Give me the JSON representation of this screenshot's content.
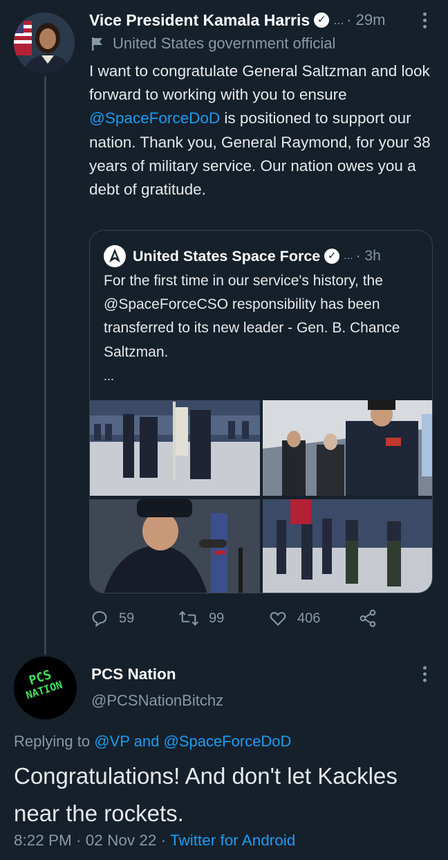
{
  "tweet": {
    "author_name": "Vice President Kamala Harris",
    "more": "...",
    "time": "· 29m",
    "label": "United States government official",
    "text_before": "I want to congratulate General Saltzman and look forward to working with you to ensure ",
    "mention": "@SpaceForceDoD",
    "text_after": " is positioned to support our nation. Thank you, General Raymond, for your 38 years of military service. Our nation owes you a debt of gratitude.",
    "quote": {
      "author_name": "United States Space Force",
      "more": "...",
      "time": "· 3h",
      "text": "For the first time in our service's history, the @SpaceForceCSO responsibility has been transferred to its new leader - Gen. B. Chance Saltzman.",
      "ellipsis": "..."
    },
    "stats": {
      "replies": "59",
      "retweets": "99",
      "likes": "406"
    }
  },
  "reply": {
    "author_name": "PCS Nation",
    "handle": "@PCSNationBitchz",
    "avatar_text_line1": "PCS",
    "avatar_text_line2": "NATION",
    "replying_prefix": "Replying to",
    "replying_to_1": "@VP",
    "replying_and": "and",
    "replying_to_2": "@SpaceForceDoD",
    "text": "Congratulations! And don't let Kackles near the rockets.",
    "time": "8:22 PM",
    "date": "02 Nov 22",
    "source": "Twitter for Android"
  },
  "colors": {
    "background": "#15202b",
    "link": "#1d9bf0",
    "muted": "#8899a6",
    "border": "#38444d",
    "pcs_green": "#3fe05f"
  },
  "icons": [
    "verified-badge-icon",
    "flag-icon",
    "space-force-logo-icon",
    "reply-icon",
    "retweet-icon",
    "like-icon",
    "share-icon",
    "more-options-icon"
  ]
}
